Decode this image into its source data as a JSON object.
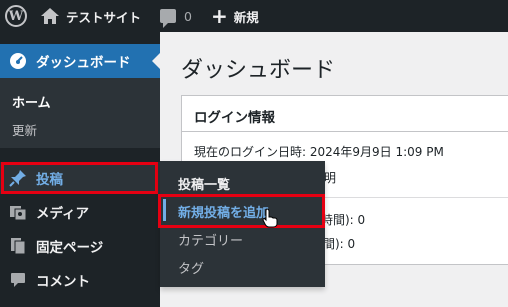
{
  "admin_bar": {
    "site_name": "テストサイト",
    "comment_count": "0",
    "new_label": "新規"
  },
  "sidebar": {
    "dashboard": "ダッシュボード",
    "dashboard_sub": [
      "ホーム",
      "更新"
    ],
    "items": [
      {
        "label": "投稿"
      },
      {
        "label": "メディア"
      },
      {
        "label": "固定ページ"
      },
      {
        "label": "コメント"
      }
    ]
  },
  "flyout": {
    "items": [
      "投稿一覧",
      "新規投稿を追加",
      "カテゴリー",
      "タグ"
    ]
  },
  "main": {
    "title": "ダッシュボード",
    "panel": {
      "title": "ログイン情報",
      "login_time": "現在のログイン日時: 2024年9月9日 1:09 PM",
      "partial_1": "不明",
      "partial_2": "時間): 0",
      "partial_3": "間): 0"
    }
  },
  "colors": {
    "admin_bg": "#1d2327",
    "accent": "#2271b1",
    "highlight": "#e60012",
    "link": "#72aee6"
  }
}
